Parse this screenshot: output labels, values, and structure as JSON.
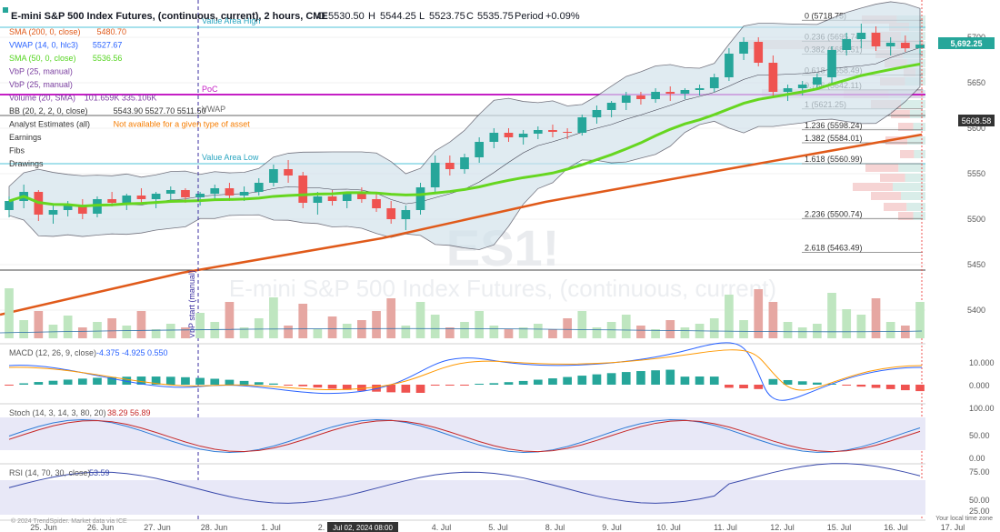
{
  "header": {
    "title": "E-mini S&P 500 Index Futures, (continuous, current), 2 hours, CME",
    "ohlc": {
      "o_label": "O",
      "o": "5530.50",
      "h_label": "H",
      "h": "5544.25",
      "l_label": "L",
      "l": "5523.75",
      "c_label": "C",
      "c": "5535.75",
      "period_label": "Period",
      "period": "+0.09%"
    }
  },
  "indicators": [
    {
      "label": "SMA (200, 0, close)",
      "value": "5480.70",
      "color": "#e05a1a"
    },
    {
      "label": "VWAP (14, 0, hlc3)",
      "value": "5527.67",
      "color": "#2962ff"
    },
    {
      "label": "SMA (50, 0, close)",
      "value": "5536.56",
      "color": "#55d420"
    },
    {
      "label": "VbP (25, manual)",
      "value": "",
      "color": "#7b3fa0"
    },
    {
      "label": "VbP (25, manual)",
      "value": "",
      "color": "#7b3fa0"
    },
    {
      "label": "Volume (20, SMA)",
      "value": "101.659K 335.106K",
      "color": "#7b3fa0"
    },
    {
      "label": "BB (20, 2, 2, 0, close)",
      "value": "5543.90 5527.70 5511.50",
      "color": "#333333"
    },
    {
      "label": "Analyst Estimates (all)",
      "value": "Not available for a given type of asset",
      "color": "#333333"
    },
    {
      "label": "Earnings",
      "value": "",
      "color": "#333333"
    },
    {
      "label": "Fibs",
      "value": "",
      "color": "#333333"
    },
    {
      "label": "Drawings",
      "value": "",
      "color": "#333333"
    }
  ],
  "watermark": {
    "symbol": "ES1!",
    "name": "E-mini S&P 500 Index Futures, (continuous, current)"
  },
  "annotations": {
    "value_area_high": "Value Area High",
    "value_area_low": "Value Area Low",
    "poc": "PoC",
    "vwap": "VWAP",
    "vbp_start": "VbP start (manual)",
    "copyright": "© 2024 TrendSpider. Market data via ICE",
    "local_time": "Your local time zone",
    "date_marker": "Jul 02, 2024 08:00"
  },
  "price_badges": {
    "current": "5,692.25",
    "sma200": "5608.58"
  },
  "fib_levels": [
    {
      "label": "0 (5718.75)",
      "price": 5718.75
    },
    {
      "label": "0.236 (5695.74)",
      "price": 5695.74
    },
    {
      "label": "0.382 (5681.51)",
      "price": 5681.51
    },
    {
      "label": "0.618 (5658.49)",
      "price": 5658.49
    },
    {
      "label": "0.786 (5642.11)",
      "price": 5642.11
    },
    {
      "label": "1 (5621.25)",
      "price": 5621.25
    },
    {
      "label": "1.236 (5598.24)",
      "price": 5598.24
    },
    {
      "label": "1.382 (5584.01)",
      "price": 5584.01
    },
    {
      "label": "1.618 (5560.99)",
      "price": 5560.99
    },
    {
      "label": "2.236 (5500.74)",
      "price": 5500.74
    },
    {
      "label": "2.618 (5463.49)",
      "price": 5463.49
    }
  ],
  "panes": {
    "macd": {
      "label": "MACD (12, 26, 9, close)",
      "values": "-4.375 -4.925 0.550"
    },
    "stoch": {
      "label": "Stoch (14, 3, 14, 3, 80, 20)",
      "values": "38.29 56.89"
    },
    "rsi": {
      "label": "RSI (14, 70, 30, close)",
      "values": "53.59"
    }
  },
  "colors": {
    "up": "#26a69a",
    "down": "#ef5350",
    "sma50": "#66d620",
    "sma200": "#e05a1a",
    "bb_fill": "#d3e3ec",
    "value_area": "#4fc3d9",
    "poc": "#c51fc5",
    "vbp_start": "#3b2fa0"
  },
  "chart_data": {
    "type": "candlestick",
    "price_axis": {
      "ticks": [
        5400,
        5450,
        5500,
        5550,
        5600,
        5650,
        5700
      ]
    },
    "macd_axis": {
      "ticks": [
        "0.000",
        "10.000"
      ]
    },
    "stoch_axis": {
      "ticks": [
        "0.00",
        "50.00",
        "100.00"
      ]
    },
    "rsi_axis": {
      "ticks": [
        "25.00",
        "50.00",
        "75.00"
      ]
    },
    "x_ticks": [
      "25. Jun",
      "26. Jun",
      "27. Jun",
      "28. Jun",
      "1. Jul",
      "2. Jul",
      "3. Jul",
      "4. Jul",
      "5. Jul",
      "8. Jul",
      "9. Jul",
      "10. Jul",
      "11. Jul",
      "12. Jul",
      "15. Jul",
      "16. Jul",
      "17. Jul"
    ],
    "candles": [
      [
        5510,
        5525,
        5502,
        5520
      ],
      [
        5520,
        5538,
        5512,
        5530
      ],
      [
        5530,
        5532,
        5498,
        5505
      ],
      [
        5505,
        5515,
        5495,
        5510
      ],
      [
        5510,
        5520,
        5503,
        5515
      ],
      [
        5515,
        5522,
        5500,
        5506
      ],
      [
        5506,
        5525,
        5502,
        5522
      ],
      [
        5522,
        5530,
        5514,
        5518
      ],
      [
        5518,
        5528,
        5510,
        5526
      ],
      [
        5526,
        5534,
        5518,
        5522
      ],
      [
        5522,
        5530,
        5512,
        5528
      ],
      [
        5528,
        5536,
        5520,
        5532
      ],
      [
        5532,
        5534,
        5518,
        5524
      ],
      [
        5524,
        5530,
        5515,
        5528
      ],
      [
        5528,
        5538,
        5522,
        5534
      ],
      [
        5534,
        5540,
        5520,
        5526
      ],
      [
        5526,
        5536,
        5520,
        5530
      ],
      [
        5530,
        5545,
        5526,
        5540
      ],
      [
        5540,
        5560,
        5536,
        5555
      ],
      [
        5555,
        5565,
        5540,
        5548
      ],
      [
        5548,
        5552,
        5512,
        5518
      ],
      [
        5518,
        5530,
        5505,
        5525
      ],
      [
        5525,
        5532,
        5515,
        5520
      ],
      [
        5520,
        5530,
        5512,
        5528
      ],
      [
        5528,
        5535,
        5518,
        5522
      ],
      [
        5522,
        5530,
        5508,
        5512
      ],
      [
        5512,
        5520,
        5495,
        5500
      ],
      [
        5500,
        5515,
        5488,
        5510
      ],
      [
        5510,
        5540,
        5505,
        5535
      ],
      [
        5535,
        5570,
        5530,
        5562
      ],
      [
        5562,
        5570,
        5548,
        5555
      ],
      [
        5555,
        5572,
        5550,
        5568
      ],
      [
        5568,
        5590,
        5562,
        5585
      ],
      [
        5585,
        5600,
        5578,
        5595
      ],
      [
        5595,
        5600,
        5585,
        5590
      ],
      [
        5590,
        5598,
        5582,
        5594
      ],
      [
        5594,
        5602,
        5588,
        5598
      ],
      [
        5598,
        5604,
        5590,
        5596
      ],
      [
        5596,
        5600,
        5588,
        5595
      ],
      [
        5595,
        5615,
        5592,
        5612
      ],
      [
        5612,
        5625,
        5605,
        5620
      ],
      [
        5620,
        5630,
        5612,
        5628
      ],
      [
        5628,
        5640,
        5620,
        5636
      ],
      [
        5636,
        5640,
        5626,
        5632
      ],
      [
        5632,
        5644,
        5628,
        5640
      ],
      [
        5640,
        5646,
        5630,
        5638
      ],
      [
        5638,
        5644,
        5632,
        5642
      ],
      [
        5642,
        5648,
        5636,
        5644
      ],
      [
        5644,
        5660,
        5640,
        5656
      ],
      [
        5656,
        5688,
        5652,
        5682
      ],
      [
        5682,
        5700,
        5675,
        5695
      ],
      [
        5695,
        5700,
        5668,
        5672
      ],
      [
        5672,
        5680,
        5635,
        5640
      ],
      [
        5640,
        5648,
        5630,
        5644
      ],
      [
        5644,
        5652,
        5636,
        5648
      ],
      [
        5648,
        5660,
        5642,
        5656
      ],
      [
        5656,
        5690,
        5650,
        5686
      ],
      [
        5686,
        5705,
        5680,
        5698
      ],
      [
        5698,
        5715,
        5688,
        5705
      ],
      [
        5705,
        5712,
        5685,
        5690
      ],
      [
        5690,
        5700,
        5680,
        5694
      ],
      [
        5694,
        5702,
        5684,
        5688
      ],
      [
        5688,
        5696,
        5682,
        5692
      ]
    ]
  }
}
